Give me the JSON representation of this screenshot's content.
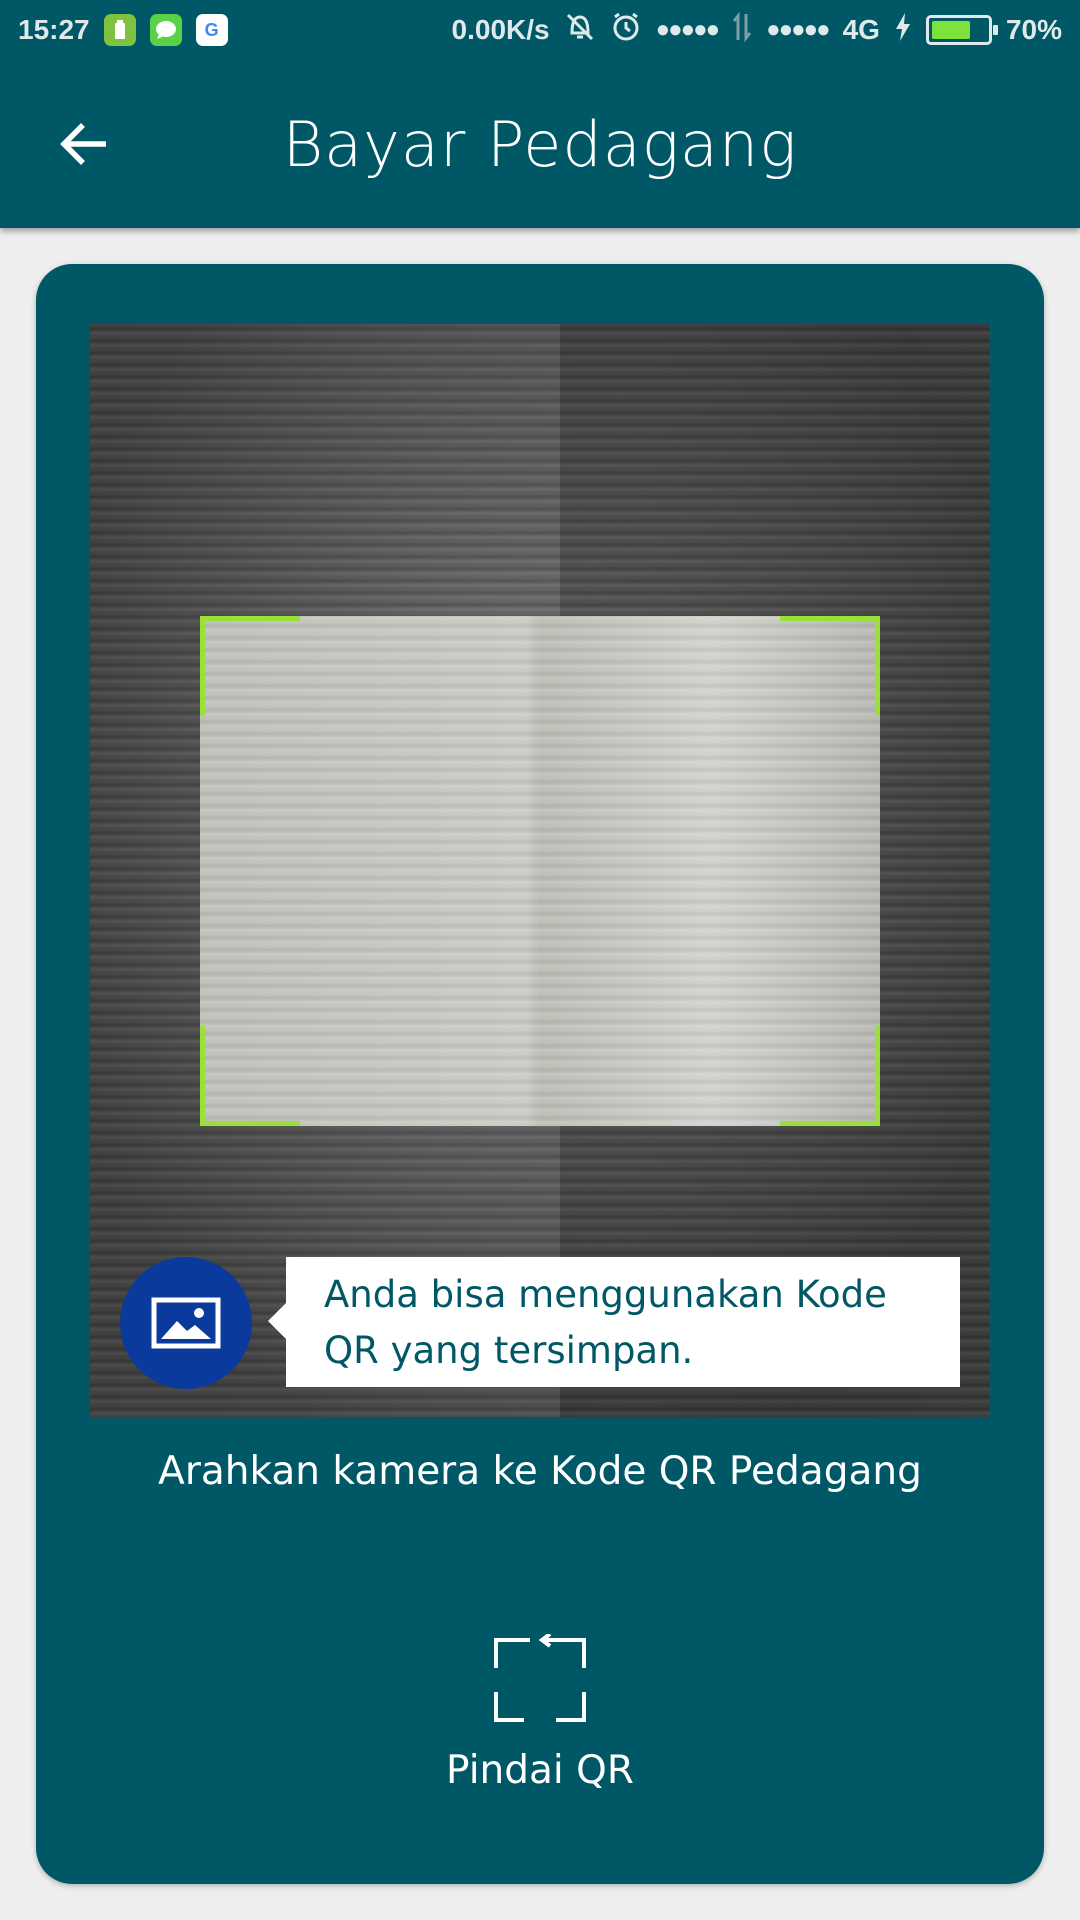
{
  "status_bar": {
    "time": "15:27",
    "network_speed": "0.00K/s",
    "signal_dots_1": "●●●●●",
    "signal_dots_2": "●●●●●",
    "network_type": "4G",
    "battery_percent": "70%",
    "battery_level": 0.7,
    "apps": [
      {
        "icon": "battery-app-icon",
        "color": "#7ec240"
      },
      {
        "icon": "message-app-icon",
        "color": "#5bd14a"
      },
      {
        "icon": "google-app-icon",
        "color": "#ffffff",
        "glyph": "G"
      }
    ]
  },
  "header": {
    "title": "Bayar Pedagang"
  },
  "scanner": {
    "tooltip": "Anda bisa menggunakan Kode QR yang tersimpan.",
    "instruction": "Arahkan kamera ke Kode QR Pedagang",
    "scan_button_label": "Pindai QR"
  },
  "colors": {
    "primary": "#005866",
    "frame_corner": "#9be03a",
    "gallery_button": "#0a3a9c"
  }
}
